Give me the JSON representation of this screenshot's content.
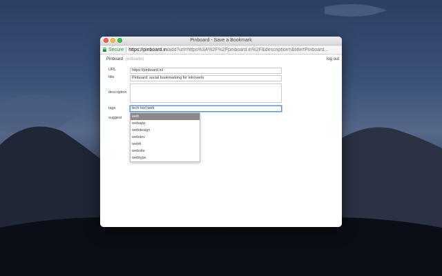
{
  "window": {
    "title": "Pinboard - Save a Bookmark"
  },
  "addressbar": {
    "secure_label": "Secure",
    "url_host": "https://pinboard.in",
    "url_rest": "/add?url=https%3A%2F%2Fpinboard.in%2F&description=&title=Pinboard..."
  },
  "header": {
    "brand": "Pinboard",
    "username": "(eldoadw)",
    "logout": "log out"
  },
  "form": {
    "url_label": "URL",
    "url_value": "https://pinboard.in/",
    "title_label": "title",
    "title_value": "Pinboard: social bookmarking for introverts",
    "description_label": "description",
    "description_value": "",
    "tags_label": "tags",
    "tags_value": "tech tool web",
    "suggest_label": "suggest"
  },
  "suggestions": [
    "web",
    "webapp",
    "webdesign",
    "webdev",
    "webtt",
    "website",
    "webtype"
  ],
  "colors": {
    "selected_option": "#8a8a8a",
    "secure": "#1e8e3e",
    "focus_border": "#5b8fd6"
  }
}
